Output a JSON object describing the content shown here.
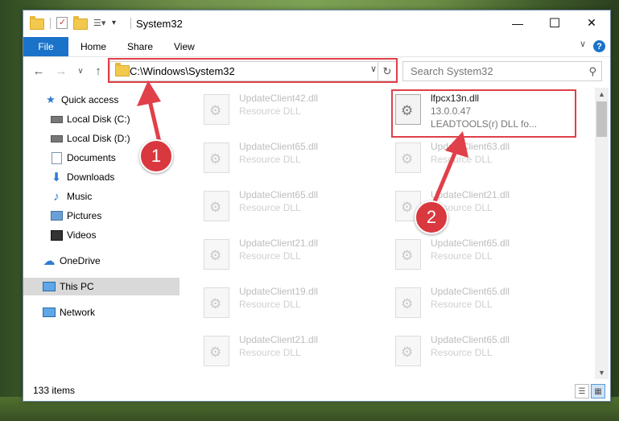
{
  "window": {
    "title": "System32",
    "minimize": "—",
    "maximize": "☐",
    "close": "✕"
  },
  "ribbon": {
    "file": "File",
    "home": "Home",
    "share": "Share",
    "view": "View",
    "help": "?",
    "collapse": "∨"
  },
  "nav": {
    "back": "←",
    "forward": "→",
    "recent": "∨",
    "up": "↑",
    "address": "C:\\Windows\\System32",
    "dropdown": "∨",
    "refresh": "↻",
    "search_placeholder": "Search System32"
  },
  "sidebar": {
    "items": [
      {
        "label": "Quick access",
        "icon": "star-icon"
      },
      {
        "label": "Local Disk (C:)",
        "icon": "drive-icon"
      },
      {
        "label": "Local Disk (D:)",
        "icon": "drive-icon"
      },
      {
        "label": "Documents",
        "icon": "documents-icon"
      },
      {
        "label": "Downloads",
        "icon": "download-icon"
      },
      {
        "label": "Music",
        "icon": "music-icon"
      },
      {
        "label": "Pictures",
        "icon": "pictures-icon"
      },
      {
        "label": "Videos",
        "icon": "videos-icon"
      },
      {
        "label": "OneDrive",
        "icon": "cloud-icon"
      },
      {
        "label": "This PC",
        "icon": "computer-icon"
      },
      {
        "label": "Network",
        "icon": "network-icon"
      }
    ]
  },
  "files": [
    {
      "name": "UpdateClient42.dll",
      "desc": "Resource DLL"
    },
    {
      "name": "lfpcx13n.dll",
      "desc": "13.0.0.47",
      "desc2": "LEADTOOLS(r) DLL fo..."
    },
    {
      "name": "UpdateClient65.dll",
      "desc": "Resource DLL"
    },
    {
      "name": "UpdateClient63.dll",
      "desc": "Resource DLL"
    },
    {
      "name": "UpdateClient65.dll",
      "desc": "Resource DLL"
    },
    {
      "name": "UpdateClient21.dll",
      "desc": "Resource DLL"
    },
    {
      "name": "UpdateClient21.dll",
      "desc": "Resource DLL"
    },
    {
      "name": "UpdateClient65.dll",
      "desc": "Resource DLL"
    },
    {
      "name": "UpdateClient19.dll",
      "desc": "Resource DLL"
    },
    {
      "name": "UpdateClient65.dll",
      "desc": "Resource DLL"
    },
    {
      "name": "UpdateClient21.dll",
      "desc": "Resource DLL"
    },
    {
      "name": "UpdateClient65.dll",
      "desc": "Resource DLL"
    }
  ],
  "status": {
    "items_count": "133 items"
  },
  "annotations": {
    "step1": "1",
    "step2": "2",
    "color": "#e0404a"
  }
}
